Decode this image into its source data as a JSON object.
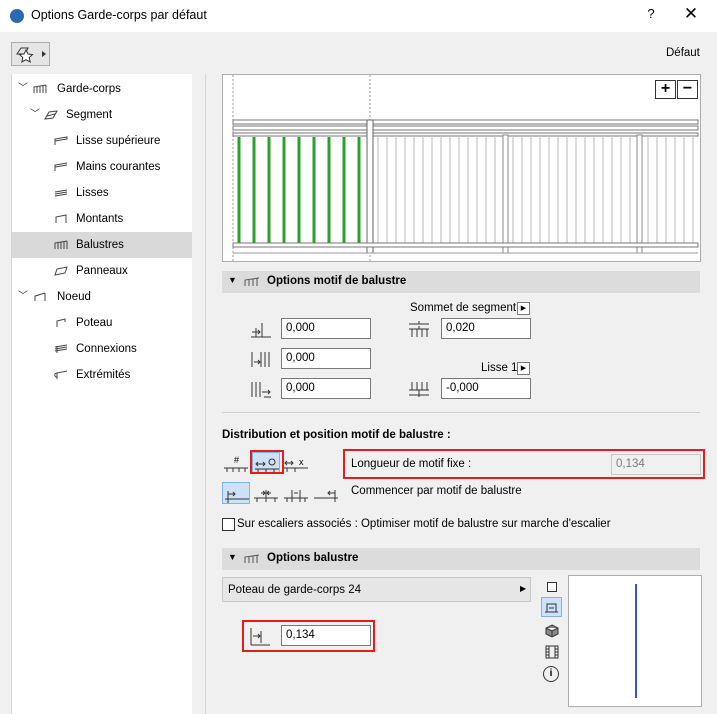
{
  "window": {
    "title": "Options Garde-corps par défaut",
    "help": "?",
    "close": "✕"
  },
  "header": {
    "default_label": "Défaut"
  },
  "tree": {
    "items": [
      {
        "label": "Garde-corps",
        "level": 0,
        "expanded": true
      },
      {
        "label": "Segment",
        "level": 1,
        "expanded": true
      },
      {
        "label": "Lisse supérieure",
        "level": 2
      },
      {
        "label": "Mains courantes",
        "level": 2
      },
      {
        "label": "Lisses",
        "level": 2
      },
      {
        "label": "Montants",
        "level": 2
      },
      {
        "label": "Balustres",
        "level": 2,
        "selected": true
      },
      {
        "label": "Panneaux",
        "level": 2
      },
      {
        "label": "Noeud",
        "level": 1,
        "expanded": true
      },
      {
        "label": "Poteau",
        "level": 2
      },
      {
        "label": "Connexions",
        "level": 2
      },
      {
        "label": "Extrémités",
        "level": 2
      }
    ]
  },
  "preview": {
    "zoom_in": "+",
    "zoom_out": "−"
  },
  "pattern_options": {
    "title": "Options motif de balustre",
    "segment_top_label": "Sommet de segment",
    "rail_label": "Lisse 1",
    "left_fields": [
      "0,000",
      "0,000",
      "0,000"
    ],
    "right_fields": [
      "0,020",
      "-0,000"
    ]
  },
  "distribution": {
    "title": "Distribution et position motif de balustre :",
    "fixed_length_label": "Longueur de motif fixe :",
    "fixed_length_value": "0,134",
    "start_label": "Commencer par motif de balustre",
    "checkbox_label": "Sur escaliers associés : Optimiser motif de balustre sur marche d'escalier",
    "checkbox_checked": false
  },
  "baluster_options": {
    "title": "Options balustre",
    "profile_select": "Poteau de garde-corps 24",
    "width_value": "0,134"
  }
}
